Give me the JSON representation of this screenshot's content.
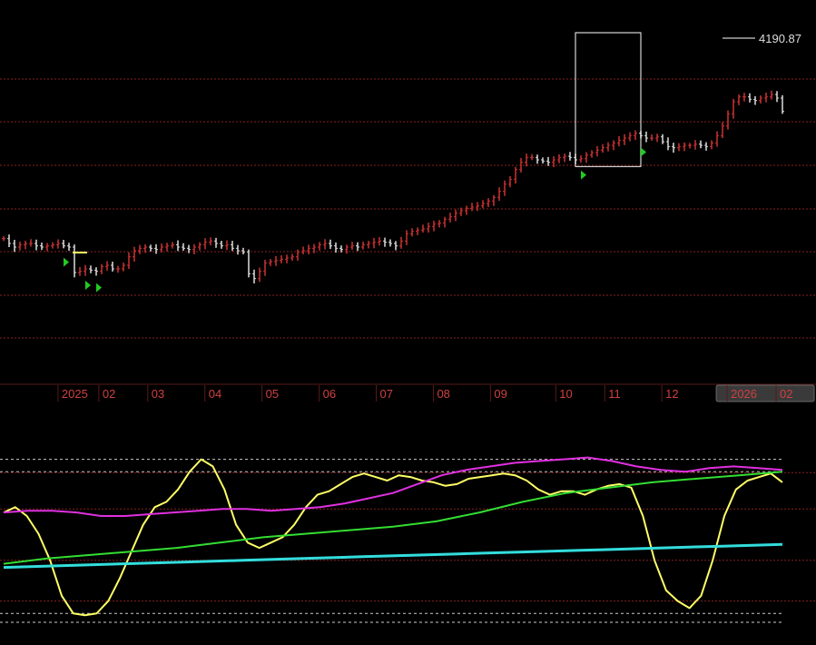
{
  "chart_data": [
    {
      "type": "line",
      "panel": "price",
      "title": "",
      "xlabel": "",
      "ylabel": "",
      "x_labels": [
        {
          "label": "2025",
          "pos": 0.08,
          "highlight": false
        },
        {
          "label": "02",
          "pos": 0.13,
          "highlight": false
        },
        {
          "label": "03",
          "pos": 0.19,
          "highlight": false
        },
        {
          "label": "04",
          "pos": 0.26,
          "highlight": false
        },
        {
          "label": "05",
          "pos": 0.33,
          "highlight": false
        },
        {
          "label": "06",
          "pos": 0.4,
          "highlight": false
        },
        {
          "label": "07",
          "pos": 0.47,
          "highlight": false
        },
        {
          "label": "08",
          "pos": 0.54,
          "highlight": false
        },
        {
          "label": "09",
          "pos": 0.61,
          "highlight": false
        },
        {
          "label": "10",
          "pos": 0.69,
          "highlight": false
        },
        {
          "label": "11",
          "pos": 0.75,
          "highlight": false
        },
        {
          "label": "12",
          "pos": 0.82,
          "highlight": false
        },
        {
          "label": "2026",
          "pos": 0.9,
          "highlight": true
        },
        {
          "label": "02",
          "pos": 0.96,
          "highlight": true
        }
      ],
      "last_price_label": "4190.87",
      "series": [
        {
          "values": [
            3365,
            3345,
            3330,
            3340,
            3345,
            3345,
            3335,
            3330,
            3335,
            3340,
            3345,
            3335,
            3330,
            3225,
            3230,
            3240,
            3235,
            3230,
            3250,
            3255,
            3240,
            3240,
            3255,
            3290,
            3315,
            3325,
            3330,
            3325,
            3320,
            3330,
            3335,
            3340,
            3330,
            3325,
            3320,
            3330,
            3340,
            3350,
            3355,
            3345,
            3335,
            3340,
            3325,
            3315,
            3310,
            3220,
            3200,
            3230,
            3265,
            3270,
            3275,
            3280,
            3285,
            3290,
            3310,
            3315,
            3325,
            3330,
            3340,
            3345,
            3335,
            3325,
            3320,
            3330,
            3335,
            3330,
            3340,
            3345,
            3350,
            3355,
            3350,
            3345,
            3335,
            3355,
            3385,
            3395,
            3400,
            3405,
            3415,
            3425,
            3430,
            3445,
            3455,
            3470,
            3480,
            3490,
            3495,
            3500,
            3510,
            3520,
            3535,
            3560,
            3590,
            3610,
            3650,
            3680,
            3700,
            3700,
            3690,
            3685,
            3680,
            3690,
            3700,
            3705,
            3700,
            3690,
            3695,
            3710,
            3720,
            3730,
            3740,
            3750,
            3760,
            3770,
            3780,
            3790,
            3800,
            3790,
            3780,
            3780,
            3785,
            3765,
            3745,
            3740,
            3745,
            3750,
            3750,
            3755,
            3750,
            3745,
            3760,
            3790,
            3830,
            3880,
            3930,
            3950,
            3950,
            3940,
            3935,
            3945,
            3950,
            3960,
            3945,
            3890
          ]
        }
      ],
      "buy_signals": [
        {
          "index": 11
        },
        {
          "index": 15
        },
        {
          "index": 17
        },
        {
          "index": 106
        },
        {
          "index": 117
        }
      ],
      "grid": true
    },
    {
      "type": "line",
      "panel": "indicator",
      "title": "",
      "xlabel": "",
      "ylabel": "",
      "reference_lines": [
        0.92,
        0.85,
        0.05,
        0.0
      ],
      "series": [
        {
          "color": "#ffff66",
          "values": [
            0.62,
            0.65,
            0.6,
            0.5,
            0.35,
            0.15,
            0.05,
            0.04,
            0.05,
            0.12,
            0.25,
            0.4,
            0.55,
            0.65,
            0.68,
            0.75,
            0.85,
            0.92,
            0.88,
            0.75,
            0.55,
            0.45,
            0.42,
            0.45,
            0.48,
            0.55,
            0.65,
            0.72,
            0.74,
            0.78,
            0.82,
            0.84,
            0.82,
            0.8,
            0.83,
            0.82,
            0.8,
            0.79,
            0.77,
            0.78,
            0.81,
            0.82,
            0.83,
            0.84,
            0.83,
            0.8,
            0.75,
            0.72,
            0.74,
            0.74,
            0.72,
            0.75,
            0.77,
            0.78,
            0.76,
            0.6,
            0.35,
            0.18,
            0.12,
            0.08,
            0.15,
            0.35,
            0.6,
            0.75,
            0.8,
            0.82,
            0.84,
            0.79
          ]
        },
        {
          "color": "#e030e0",
          "values": [
            0.62,
            0.63,
            0.63,
            0.62,
            0.6,
            0.6,
            0.61,
            0.62,
            0.63,
            0.64,
            0.64,
            0.63,
            0.64,
            0.65,
            0.67,
            0.7,
            0.73,
            0.78,
            0.83,
            0.86,
            0.88,
            0.9,
            0.91,
            0.92,
            0.93,
            0.91,
            0.88,
            0.86,
            0.85,
            0.87,
            0.88,
            0.87,
            0.86
          ]
        },
        {
          "color": "#33dd33",
          "values": [
            0.33,
            0.36,
            0.38,
            0.4,
            0.42,
            0.45,
            0.48,
            0.5,
            0.52,
            0.54,
            0.57,
            0.62,
            0.68,
            0.73,
            0.76,
            0.79,
            0.81,
            0.83,
            0.85
          ]
        },
        {
          "color": "#33dddd",
          "values": [
            0.31,
            0.32,
            0.33,
            0.34,
            0.35,
            0.36,
            0.37,
            0.38,
            0.39,
            0.4,
            0.41,
            0.42,
            0.43,
            0.44
          ]
        }
      ]
    }
  ],
  "colors": {
    "up": "#cc3333",
    "down": "#dddddd",
    "grid": "#8a2020",
    "axis_text": "#d04040",
    "axis_highlight_bg": "#3a3a3a",
    "signal": "#22cc22",
    "box": "#ffffff"
  }
}
